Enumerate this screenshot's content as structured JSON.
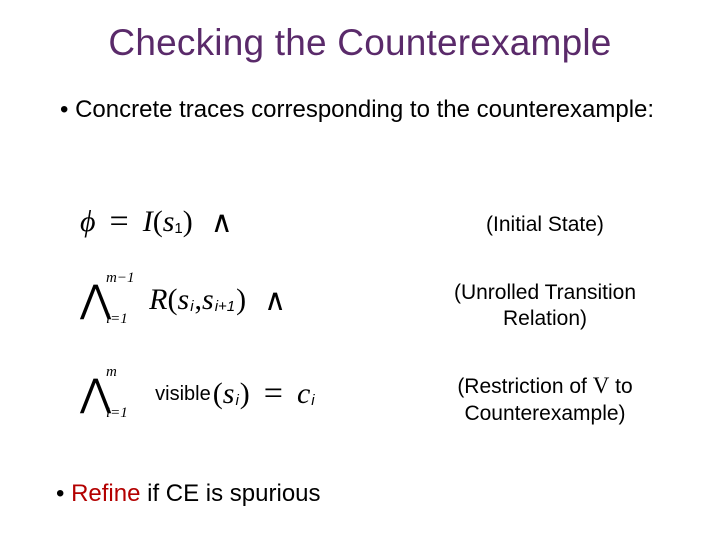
{
  "title": "Checking the Counterexample",
  "bullet1_prefix": "• ",
  "bullet1_text": "Concrete traces corresponding to the counterexample:",
  "formula1": {
    "phi": "ϕ",
    "eq": "=",
    "I": "I",
    "open": "(",
    "s": "s",
    "sub": "1",
    "close": ")",
    "wedge": "∧"
  },
  "label1": "(Initial State)",
  "formula2": {
    "bigwedge": "⋀",
    "sup": "m−1",
    "sub": "i=1",
    "R": "R",
    "open": "(",
    "s1": "s",
    "s1sub": "i",
    "comma": ", ",
    "s2": "s",
    "s2sub": "i+1",
    "close": ")",
    "wedge": "∧"
  },
  "label2_l1": "(Unrolled Transition",
  "label2_l2": "Relation)",
  "formula3": {
    "bigwedge": "⋀",
    "sup": "m",
    "sub": "i=1",
    "visible": "visible",
    "open": "(",
    "s": "s",
    "ssub": "i",
    "close": ")",
    "eq": "=",
    "c": "c",
    "csub": "i"
  },
  "label3_pre": "(Restriction of ",
  "label3_v": "V",
  "label3_post": " to",
  "label3_l2": "Counterexample)",
  "bullet2_prefix": "• ",
  "bullet2_refine": "Refine",
  "bullet2_rest": " if CE is spurious"
}
